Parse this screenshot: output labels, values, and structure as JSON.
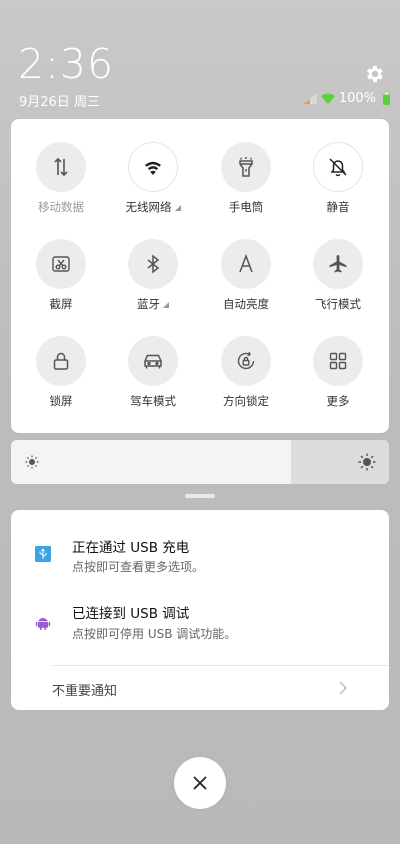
{
  "status": {
    "time": "2:36",
    "date": "9月26日 周三",
    "battery_text": "100%"
  },
  "tiles": [
    {
      "label": "移动数据",
      "icon": "mobile-data-icon",
      "state": "off",
      "caret": false
    },
    {
      "label": "无线网络",
      "icon": "wifi-icon",
      "state": "on",
      "caret": true
    },
    {
      "label": "手电筒",
      "icon": "flashlight-icon",
      "state": "off",
      "caret": false
    },
    {
      "label": "静音",
      "icon": "mute-bell-icon",
      "state": "on",
      "caret": false
    },
    {
      "label": "截屏",
      "icon": "screenshot-icon",
      "state": "off",
      "caret": false
    },
    {
      "label": "蓝牙",
      "icon": "bluetooth-icon",
      "state": "off",
      "caret": true
    },
    {
      "label": "自动亮度",
      "icon": "auto-brightness-icon",
      "state": "off",
      "caret": false
    },
    {
      "label": "飞行模式",
      "icon": "airplane-icon",
      "state": "off",
      "caret": false
    },
    {
      "label": "锁屏",
      "icon": "lock-icon",
      "state": "off",
      "caret": false
    },
    {
      "label": "驾车模式",
      "icon": "car-icon",
      "state": "off",
      "caret": false
    },
    {
      "label": "方向锁定",
      "icon": "rotation-lock-icon",
      "state": "off",
      "caret": false
    },
    {
      "label": "更多",
      "icon": "grid-icon",
      "state": "off",
      "caret": false
    }
  ],
  "brightness": {
    "level": 0.74
  },
  "notifications": [
    {
      "title": "正在通过 USB 充电",
      "subtitle": "点按即可查看更多选项。",
      "icon": "usb-icon",
      "accent": "#3aa3e3"
    },
    {
      "title": "已连接到 USB 调试",
      "subtitle": "点按即可停用 USB 调试功能。",
      "icon": "android-icon",
      "accent": "#9b5ad6"
    }
  ],
  "less_important_label": "不重要通知",
  "colors": {
    "wifi_status": "#5fcf3c",
    "signal_status": "#e8a03a",
    "battery": "#5fcf3c"
  }
}
